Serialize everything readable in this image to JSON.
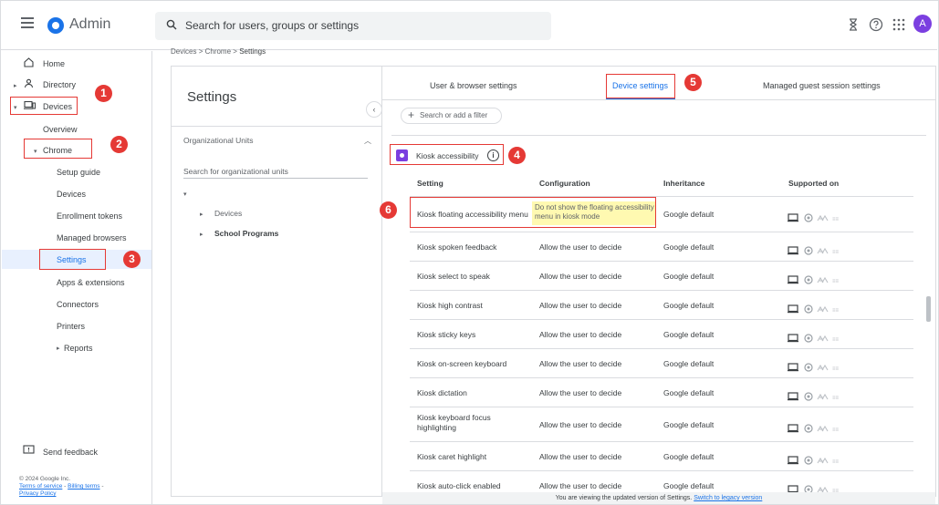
{
  "header": {
    "app_title": "Admin",
    "search_placeholder": "Search for users, groups or settings",
    "avatar_letter": "A"
  },
  "nav": {
    "home": "Home",
    "directory": "Directory",
    "devices": "Devices",
    "overview": "Overview",
    "chrome": "Chrome",
    "setup_guide": "Setup guide",
    "devices_sub": "Devices",
    "enrollment_tokens": "Enrollment tokens",
    "managed_browsers": "Managed browsers",
    "settings": "Settings",
    "apps_extensions": "Apps & extensions",
    "connectors": "Connectors",
    "printers": "Printers",
    "reports": "Reports",
    "send_feedback": "Send feedback"
  },
  "footer": {
    "copyright": "© 2024 Google Inc.",
    "terms": "Terms of service",
    "billing": "Billing terms",
    "privacy": "Privacy Policy"
  },
  "breadcrumb": {
    "devices": "Devices",
    "chrome": "Chrome",
    "settings": "Settings"
  },
  "panel": {
    "title": "Settings",
    "ou_title": "Organizational Units",
    "ou_search_placeholder": "Search for organizational units",
    "tree": [
      "Devices",
      "School Programs"
    ]
  },
  "tabs": [
    "User & browser settings",
    "Device settings",
    "Managed guest session settings"
  ],
  "filter_placeholder": "Search or add a filter",
  "section": {
    "title": "Kiosk accessibility",
    "columns": [
      "Setting",
      "Configuration",
      "Inheritance",
      "Supported on"
    ],
    "rows": [
      {
        "setting": "Kiosk floating accessibility menu",
        "configuration": "Do not show the floating accessibility menu in kiosk mode",
        "inheritance": "Google default"
      },
      {
        "setting": "Kiosk spoken feedback",
        "configuration": "Allow the user to decide",
        "inheritance": "Google default"
      },
      {
        "setting": "Kiosk select to speak",
        "configuration": "Allow the user to decide",
        "inheritance": "Google default"
      },
      {
        "setting": "Kiosk high contrast",
        "configuration": "Allow the user to decide",
        "inheritance": "Google default"
      },
      {
        "setting": "Kiosk sticky keys",
        "configuration": "Allow the user to decide",
        "inheritance": "Google default"
      },
      {
        "setting": "Kiosk on-screen keyboard",
        "configuration": "Allow the user to decide",
        "inheritance": "Google default"
      },
      {
        "setting": "Kiosk dictation",
        "configuration": "Allow the user to decide",
        "inheritance": "Google default"
      },
      {
        "setting": "Kiosk keyboard focus highlighting",
        "configuration": "Allow the user to decide",
        "inheritance": "Google default"
      },
      {
        "setting": "Kiosk caret highlight",
        "configuration": "Allow the user to decide",
        "inheritance": "Google default"
      },
      {
        "setting": "Kiosk auto-click enabled",
        "configuration": "Allow the user to decide",
        "inheritance": "Google default"
      }
    ]
  },
  "banner": {
    "text": "You are viewing the updated version of Settings.",
    "link": "Switch to legacy version"
  },
  "badges": [
    "1",
    "2",
    "3",
    "4",
    "5",
    "6"
  ],
  "colors": {
    "accent": "#1a73e8",
    "annotation": "#e53935",
    "highlight": "#fff9b1",
    "active_bg": "#e8f0fe"
  }
}
